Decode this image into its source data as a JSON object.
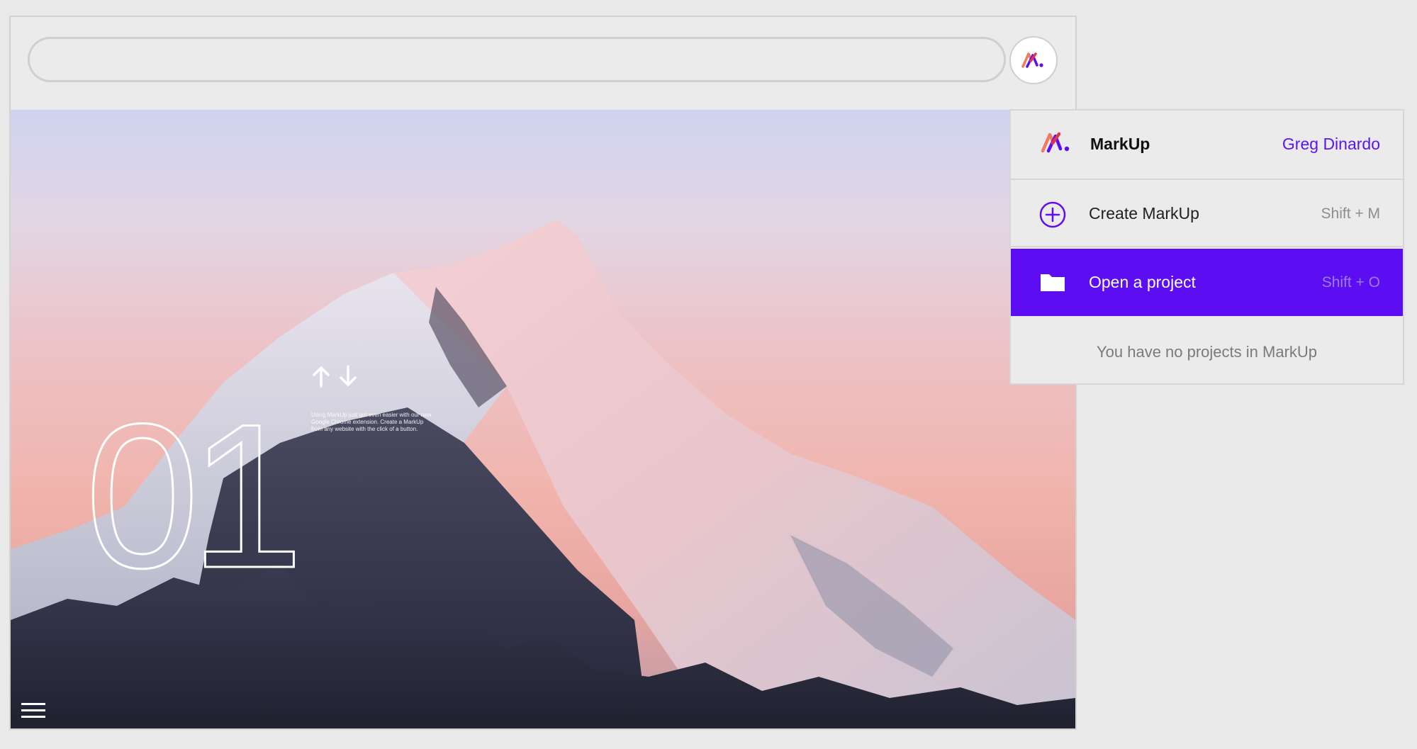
{
  "browser": {
    "address_bar": {
      "value": "",
      "placeholder": ""
    },
    "extension_button": {
      "icon": "markup-logo-icon"
    }
  },
  "hero": {
    "number": "01",
    "promo_text": "Using MarkUp just got even easier with our new Google Chrome extension. Create a MarkUp from any website with the click of a button.",
    "icons": [
      "arrow-up-icon",
      "arrow-down-icon",
      "hamburger-menu-icon"
    ]
  },
  "dropdown": {
    "brand": "MarkUp",
    "user_name": "Greg Dinardo",
    "items": [
      {
        "label": "Create MarkUp",
        "shortcut": "Shift + M",
        "icon": "plus-circle-icon"
      },
      {
        "label": "Open a project",
        "shortcut": "Shift + O",
        "icon": "folder-icon"
      }
    ],
    "empty_message": "You have no projects in MarkUp"
  },
  "colors": {
    "accent": "#5d0df2",
    "user_name": "#5b14f2",
    "background": "#e9e9e9"
  }
}
